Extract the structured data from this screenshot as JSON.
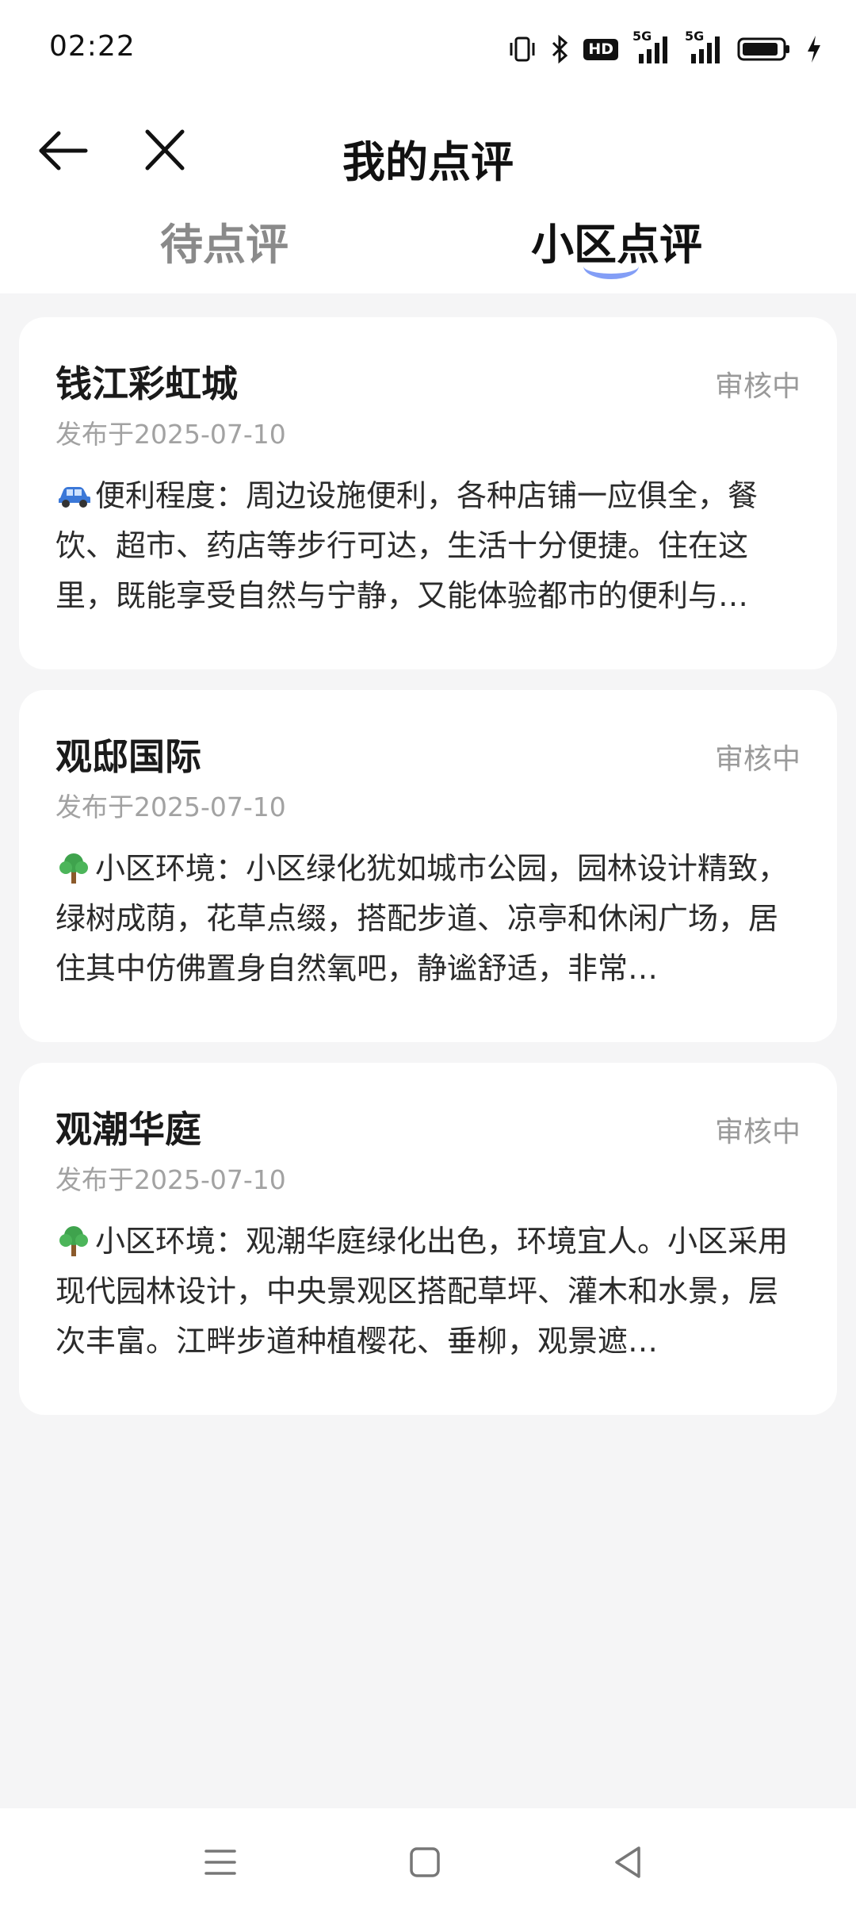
{
  "status_bar": {
    "time": "02:22",
    "hd_label": "HD",
    "signal1_label": "5G",
    "signal2_label": "5G"
  },
  "header": {
    "title": "我的点评"
  },
  "tabs": [
    {
      "label": "待点评",
      "active": false
    },
    {
      "label": "小区点评",
      "active": true
    }
  ],
  "colors": {
    "accent": "#6e8ef5",
    "background": "#f5f5f6",
    "card": "#ffffff",
    "muted": "#9a9a9a"
  },
  "reviews": [
    {
      "title": "钱江彩虹城",
      "status": "审核中",
      "date": "发布于2025-07-10",
      "emoji": "car-icon",
      "text": "便利程度：周边设施便利，各种店铺一应俱全，餐饮、超市、药店等步行可达，生活十分便捷。住在这里，既能享受自然与宁静，又能体验都市的便利与…"
    },
    {
      "title": "观邸国际",
      "status": "审核中",
      "date": "发布于2025-07-10",
      "emoji": "tree-icon",
      "text": "小区环境：小区绿化犹如城市公园，园林设计精致，绿树成荫，花草点缀，搭配步道、凉亭和休闲广场，居住其中仿佛置身自然氧吧，静谧舒适，非常…"
    },
    {
      "title": "观潮华庭",
      "status": "审核中",
      "date": "发布于2025-07-10",
      "emoji": "tree-icon",
      "text": "小区环境：观潮华庭绿化出色，环境宜人。小区采用现代园林设计，中央景观区搭配草坪、灌木和水景，层次丰富。江畔步道种植樱花、垂柳，观景遮…"
    }
  ]
}
